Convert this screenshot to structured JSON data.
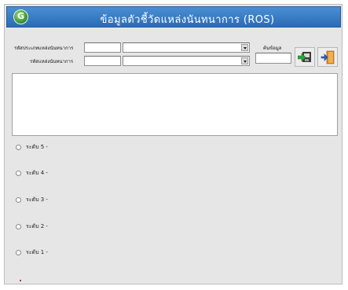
{
  "window": {
    "title": "ข้อมูลตัวชี้วัดแหล่งนันทนาการ (ROS)",
    "logo_letter": "G"
  },
  "form": {
    "type_code_label": "รหัสประเภทแหล่งนันทนาการ",
    "site_code_label": "รหัสแหล่งนันทนาการ",
    "search_label": "ค้นข้อมูล",
    "type_code_value": "",
    "type_name_value": "",
    "site_code_value": "",
    "site_name_value": "",
    "search_value": ""
  },
  "buttons": {
    "save_icon": "save-arrow-icon",
    "exit_icon": "exit-door-icon"
  },
  "levels": [
    {
      "label": "ระดับ 5 -"
    },
    {
      "label": "ระดับ 4 -"
    },
    {
      "label": "ระดับ 3 -"
    },
    {
      "label": "ระดับ 2 -"
    },
    {
      "label": "ระดับ 1 -"
    }
  ],
  "colors": {
    "titlebar": "#2b6cb5",
    "background": "#e6e6e6"
  }
}
